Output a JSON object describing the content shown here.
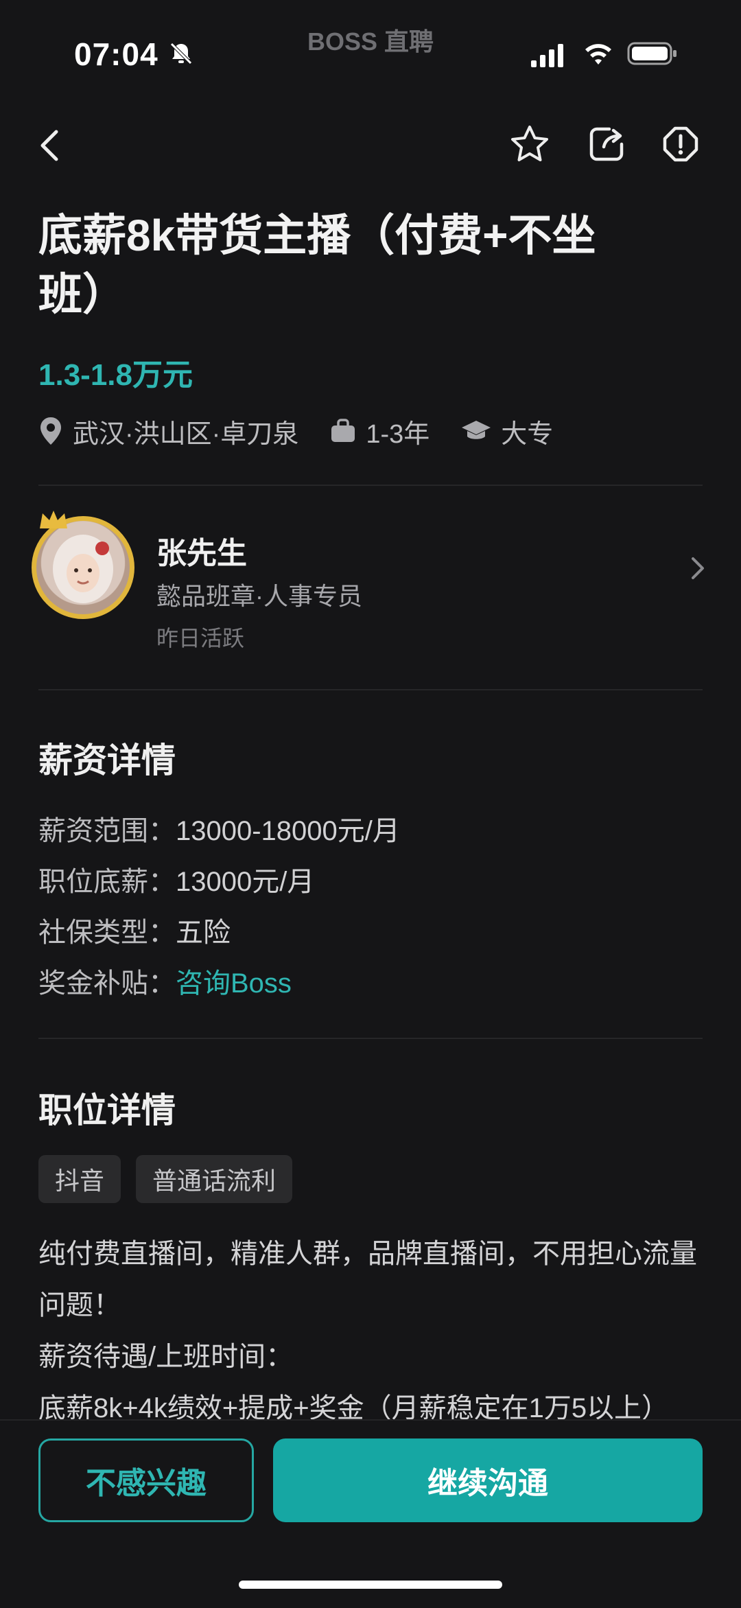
{
  "status_bar": {
    "time": "07:04",
    "watermark": "BOSS 直聘",
    "icons": [
      "bell-muted-icon",
      "signal-icon",
      "wifi-icon",
      "battery-icon"
    ]
  },
  "nav": {
    "icons": [
      "back-arrow-icon",
      "star-icon",
      "share-icon",
      "report-icon"
    ]
  },
  "job": {
    "title": "底薪8k带货主播（付费+不坐班）",
    "salary": "1.3-1.8万元",
    "location": "武汉·洪山区·卓刀泉",
    "experience": "1-3年",
    "education": "大专"
  },
  "recruiter": {
    "name": "张先生",
    "title": "懿品班章·人事专员",
    "activity": "昨日活跃"
  },
  "salary_details": {
    "heading": "薪资详情",
    "rows": [
      {
        "label": "薪资范围：",
        "value": "13000-18000元/月"
      },
      {
        "label": "职位底薪：",
        "value": "13000元/月"
      },
      {
        "label": "社保类型：",
        "value": "五险"
      },
      {
        "label": "奖金补贴：",
        "value": "咨询Boss"
      }
    ]
  },
  "job_details": {
    "heading": "职位详情",
    "tags": [
      "抖音",
      "普通话流利"
    ],
    "description": [
      "纯付费直播间，精准人群，品牌直播间，不用担心流量问题！",
      "薪资待遇/上班时间：",
      "底薪8k+4k绩效+提成+奖金（月薪稳定在1万5以上）"
    ]
  },
  "actions": {
    "not_interested": "不感兴趣",
    "continue_chat": "继续沟通"
  },
  "colors": {
    "background": "#151517",
    "accent": "#16a7a3",
    "salary": "#2fb6b2",
    "avatar_ring": "#e1b63c"
  }
}
